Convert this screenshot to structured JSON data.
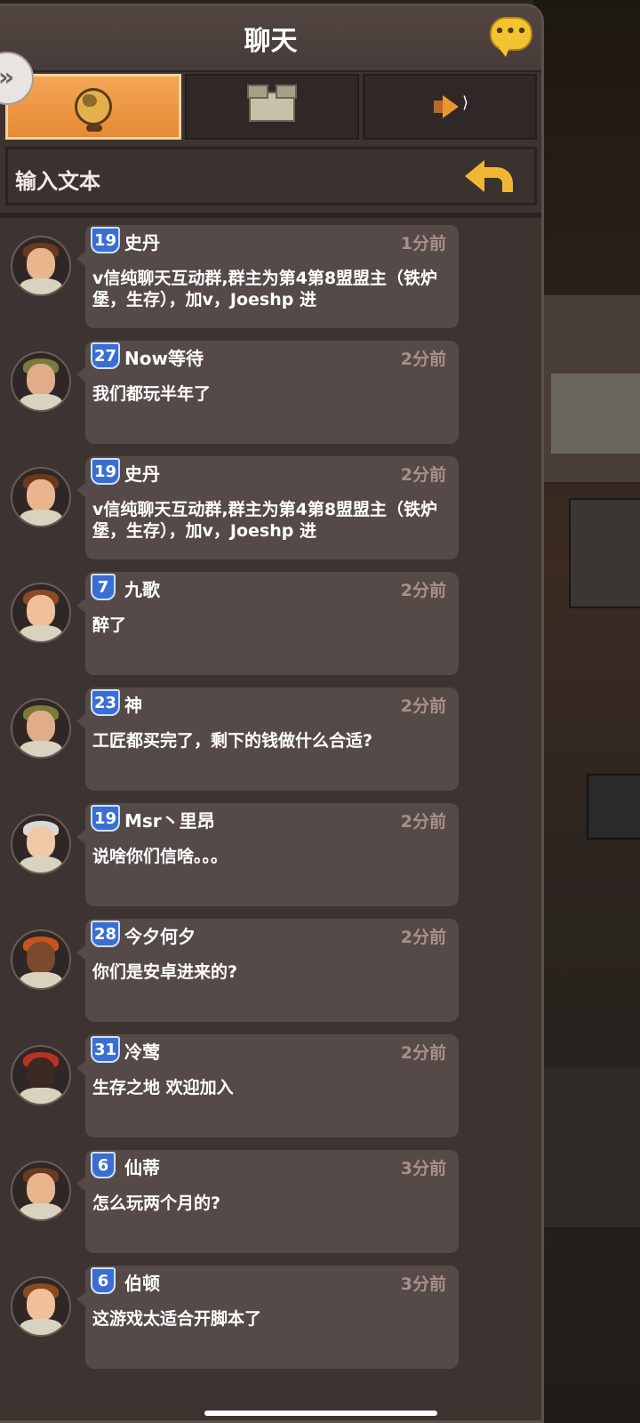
{
  "header": {
    "title": "聊天"
  },
  "tabs": [
    {
      "id": "world",
      "icon": "globe-icon",
      "active": true
    },
    {
      "id": "alliance",
      "icon": "castle-icon",
      "active": false
    },
    {
      "id": "announce",
      "icon": "megaphone-icon",
      "active": false
    }
  ],
  "input": {
    "placeholder": "输入文本"
  },
  "messages": [
    {
      "level": "19",
      "name": "史丹",
      "time": "1分前",
      "text": "v信纯聊天互动群,群主为第4第8盟盟主（铁炉堡，生存），加v，Joeshp 进"
    },
    {
      "level": "27",
      "name": "Now等待",
      "time": "2分前",
      "text": "我们都玩半年了"
    },
    {
      "level": "19",
      "name": "史丹",
      "time": "2分前",
      "text": "v信纯聊天互动群,群主为第4第8盟盟主（铁炉堡，生存），加v，Joeshp 进"
    },
    {
      "level": "7",
      "name": "九歌",
      "time": "2分前",
      "text": "醉了"
    },
    {
      "level": "23",
      "name": "神",
      "time": "2分前",
      "text": "工匠都买完了，剩下的钱做什么合适?"
    },
    {
      "level": "19",
      "name": "Msr丶里昂",
      "time": "2分前",
      "text": "说啥你们信啥。。。"
    },
    {
      "level": "28",
      "name": "今夕何夕",
      "time": "2分前",
      "text": "你们是安卓进来的?"
    },
    {
      "level": "31",
      "name": "冷莺",
      "time": "2分前",
      "text": "生存之地 欢迎加入"
    },
    {
      "level": "6",
      "name": "仙蒂",
      "time": "3分前",
      "text": "怎么玩两个月的?"
    },
    {
      "level": "6",
      "name": "伯顿",
      "time": "3分前",
      "text": "这游戏太适合开脚本了"
    }
  ]
}
